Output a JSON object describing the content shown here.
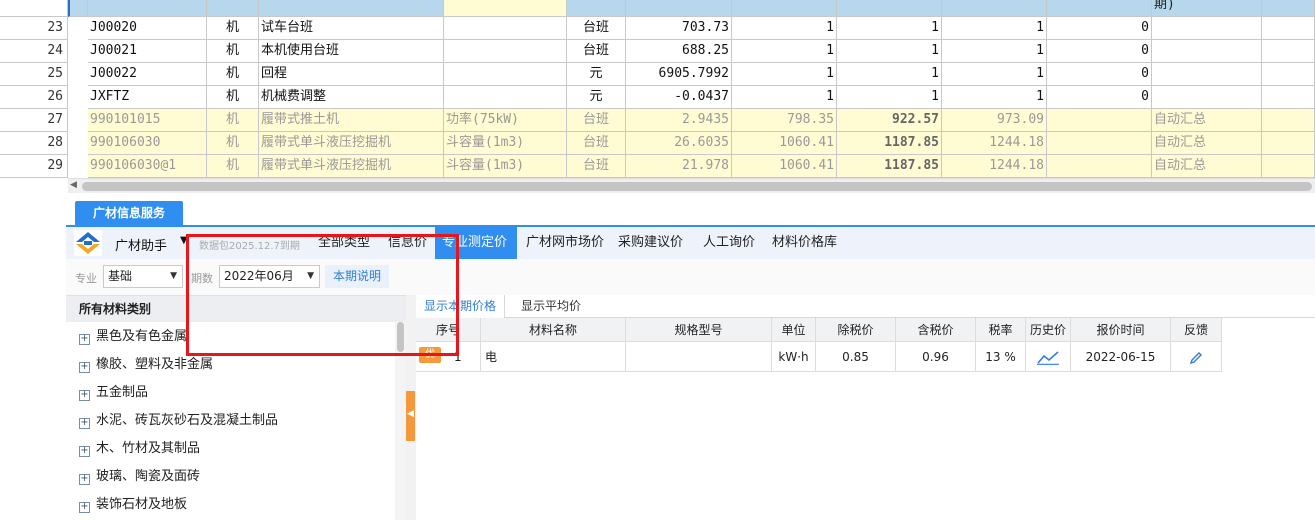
{
  "sheet": {
    "header_note": "期)",
    "rows": [
      {
        "rn": "23",
        "code": "J00020",
        "type": "机",
        "name": "试车台班",
        "spec": "",
        "unit": "台班",
        "n1": "703.73",
        "n2": "1",
        "n3": "1",
        "n4": "1",
        "n5": "0",
        "note": "",
        "style": "plain"
      },
      {
        "rn": "24",
        "code": "J00021",
        "type": "机",
        "name": "本机使用台班",
        "spec": "",
        "unit": "台班",
        "n1": "688.25",
        "n2": "1",
        "n3": "1",
        "n4": "1",
        "n5": "0",
        "note": "",
        "style": "plain"
      },
      {
        "rn": "25",
        "code": "J00022",
        "type": "机",
        "name": "回程",
        "spec": "",
        "unit": "元",
        "n1": "6905.7992",
        "n2": "1",
        "n3": "1",
        "n4": "1",
        "n5": "0",
        "note": "",
        "style": "plain"
      },
      {
        "rn": "26",
        "code": "JXFTZ",
        "type": "机",
        "name": "机械费调整",
        "spec": "",
        "unit": "元",
        "n1": "-0.0437",
        "n2": "1",
        "n3": "1",
        "n4": "1",
        "n5": "0",
        "note": "",
        "style": "plain"
      },
      {
        "rn": "27",
        "code": "990101015",
        "type": "机",
        "name": "履带式推土机",
        "spec": "功率(75kW)",
        "unit": "台班",
        "n1": "2.9435",
        "n2": "798.35",
        "n3": "922.57",
        "n4": "973.09",
        "n5": "",
        "note": "自动汇总",
        "style": "auto"
      },
      {
        "rn": "28",
        "code": "990106030",
        "type": "机",
        "name": "履带式单斗液压挖掘机",
        "spec": "斗容量(1m3)",
        "unit": "台班",
        "n1": "26.6035",
        "n2": "1060.41",
        "n3": "1187.85",
        "n4": "1244.18",
        "n5": "",
        "note": "自动汇总",
        "style": "auto"
      },
      {
        "rn": "29",
        "code": "990106030@1",
        "type": "机",
        "name": "履带式单斗液压挖掘机",
        "spec": "斗容量(1m3)",
        "unit": "台班",
        "n1": "21.978",
        "n2": "1060.41",
        "n3": "1187.85",
        "n4": "1244.18",
        "n5": "",
        "note": "自动汇总",
        "style": "auto"
      }
    ]
  },
  "panel": {
    "tab_label": "广材信息服务",
    "brand": "广材助手",
    "brand_caret": "▼",
    "package_info": "数据包2025.12.7到期",
    "nav": [
      "全部类型",
      "信息价",
      "专业测定价",
      "广材网市场价",
      "采购建议价",
      "人工询价",
      "材料价格库"
    ],
    "active_nav": 2
  },
  "filter": {
    "major_label": "专业",
    "major_value": "基础",
    "period_label": "期数",
    "period_value": "2022年06月",
    "note_button": "本期说明",
    "caret": "▼"
  },
  "tree": {
    "header": "所有材料类别",
    "items": [
      "黑色及有色金属",
      "橡胶、塑料及非金属",
      "五金制品",
      "水泥、砖瓦灰砂石及混凝土制品",
      "木、竹材及其制品",
      "玻璃、陶瓷及面砖",
      "装饰石材及地板"
    ]
  },
  "splitter_arrow": "◀",
  "scroll_arrow": "◀",
  "price": {
    "subtabs": [
      "显示本期价格",
      "显示平均价"
    ],
    "columns": [
      "序号",
      "材料名称",
      "规格型号",
      "单位",
      "除税价",
      "含税价",
      "税率",
      "历史价",
      "报价时间",
      "反馈"
    ],
    "rows": [
      {
        "seq": "1",
        "badge": "优",
        "name": "电",
        "spec": "",
        "unit": "kW·h",
        "ex_tax": "0.85",
        "in_tax": "0.96",
        "rate": "13 %",
        "time": "2022-06-15"
      }
    ]
  },
  "colors": {
    "accent": "#2f8ef0",
    "annotation": "#e8151b",
    "highlight": "#fffcd3",
    "handle": "#f59a3c"
  }
}
